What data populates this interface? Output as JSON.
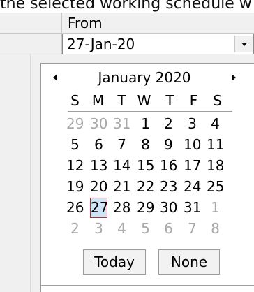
{
  "caption": "the selected working schedule w",
  "grid": {
    "column_header": "From",
    "date_value": "27-Jan-20"
  },
  "calendar": {
    "month_title": "January 2020",
    "weekdays": [
      "S",
      "M",
      "T",
      "W",
      "T",
      "F",
      "S"
    ],
    "weeks": [
      [
        {
          "d": "29",
          "o": true
        },
        {
          "d": "30",
          "o": true
        },
        {
          "d": "31",
          "o": true
        },
        {
          "d": "1"
        },
        {
          "d": "2"
        },
        {
          "d": "3"
        },
        {
          "d": "4"
        }
      ],
      [
        {
          "d": "5"
        },
        {
          "d": "6"
        },
        {
          "d": "7"
        },
        {
          "d": "8"
        },
        {
          "d": "9"
        },
        {
          "d": "10"
        },
        {
          "d": "11"
        }
      ],
      [
        {
          "d": "12"
        },
        {
          "d": "13"
        },
        {
          "d": "14"
        },
        {
          "d": "15"
        },
        {
          "d": "16"
        },
        {
          "d": "17"
        },
        {
          "d": "18"
        }
      ],
      [
        {
          "d": "19"
        },
        {
          "d": "20"
        },
        {
          "d": "21"
        },
        {
          "d": "22"
        },
        {
          "d": "23"
        },
        {
          "d": "24"
        },
        {
          "d": "25"
        }
      ],
      [
        {
          "d": "26"
        },
        {
          "d": "27",
          "sel": true
        },
        {
          "d": "28"
        },
        {
          "d": "29"
        },
        {
          "d": "30"
        },
        {
          "d": "31"
        },
        {
          "d": "1",
          "o": true
        }
      ],
      [
        {
          "d": "2",
          "o": true
        },
        {
          "d": "3",
          "o": true
        },
        {
          "d": "4",
          "o": true
        },
        {
          "d": "5",
          "o": true
        },
        {
          "d": "6",
          "o": true
        },
        {
          "d": "7",
          "o": true
        },
        {
          "d": "8",
          "o": true
        }
      ]
    ],
    "today_label": "Today",
    "none_label": "None"
  },
  "icons": {
    "dropdown": "chevron-down-icon",
    "prev": "triangle-left-icon",
    "next": "triangle-right-icon"
  },
  "colors": {
    "selected_fill": "#cfe3f7",
    "selected_border": "#b03030",
    "other_month_text": "#a8a8a8"
  }
}
